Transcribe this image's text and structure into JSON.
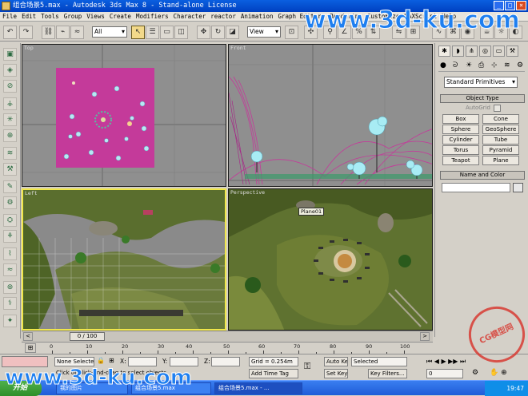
{
  "window": {
    "title": "组合场景5.max - Autodesk 3ds Max 8 - Stand-alone License"
  },
  "menu": [
    "File",
    "Edit",
    "Tools",
    "Group",
    "Views",
    "Create",
    "Modifiers",
    "Character",
    "reactor",
    "Animation",
    "Graph Editors",
    "Rendering",
    "Customize",
    "MAXScript",
    "Help"
  ],
  "toolbar": {
    "selection_filter": "All",
    "ref_coord": "View"
  },
  "viewports": {
    "top": "Top",
    "front": "Front",
    "left": "Left",
    "perspective": "Perspective",
    "object_label": "Plane01"
  },
  "command_panel": {
    "dropdown": "Standard Primitives",
    "object_type_header": "Object Type",
    "autogrid": "AutoGrid",
    "primitives": [
      "Box",
      "Cone",
      "Sphere",
      "GeoSphere",
      "Cylinder",
      "Tube",
      "Torus",
      "Pyramid",
      "Teapot",
      "Plane"
    ],
    "name_color_header": "Name and Color"
  },
  "timeline": {
    "slider": "0 / 100",
    "ticks": [
      "0",
      "10",
      "20",
      "30",
      "40",
      "50",
      "60",
      "70",
      "80",
      "90",
      "100"
    ]
  },
  "status": {
    "selection": "None Selecte",
    "x_label": "X:",
    "y_label": "Y:",
    "z_label": "Z:",
    "grid": "Grid = 0.254m",
    "add_time_tag": "Add Time Tag",
    "prompt": "Click or click-and-drag to select objects",
    "auto_key": "Auto Key",
    "set_key": "Set Key",
    "key_mode": "Selected",
    "key_filters": "Key Filters...",
    "frame": "0"
  },
  "taskbar": {
    "start": "开始",
    "tasks": [
      "我的图片",
      "组合场景5.max",
      "组合场景5.max - ..."
    ],
    "clock": "19:47"
  },
  "watermarks": {
    "top": "www.3d-ku.com",
    "bottom": "www.3d-ku.com",
    "stamp": "CG模型网"
  },
  "colors": {
    "active_viewport_border": "#f0e64a",
    "magenta_plane": "#c43a9a",
    "taskbar": "#2a6ae6",
    "watermark": "#1e7ff0"
  }
}
